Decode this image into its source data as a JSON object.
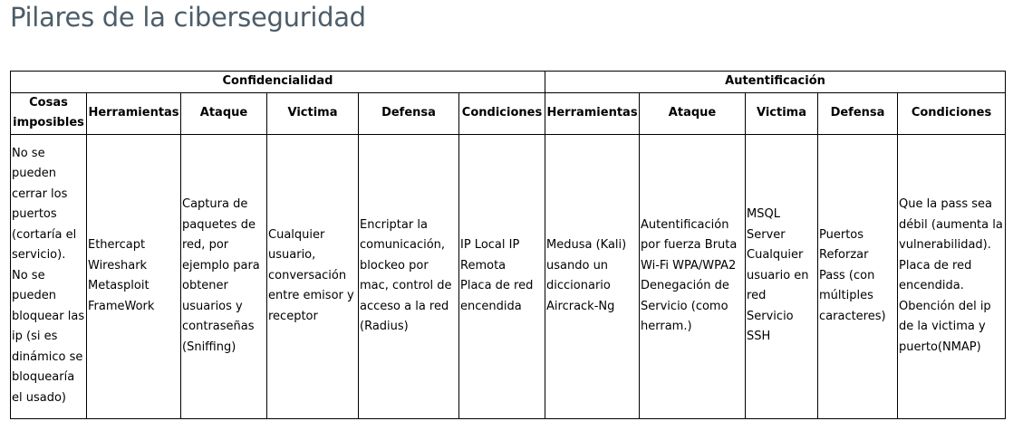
{
  "title": "Pilares de la ciberseguridad",
  "groups": [
    {
      "label": "Confidencialidad",
      "span": 6
    },
    {
      "label": "Autentificación",
      "span": 5
    }
  ],
  "columns": [
    "Cosas imposibles",
    "Herramientas",
    "Ataque",
    "Victima",
    "Defensa",
    "Condiciones",
    "Herramientas",
    "Ataque",
    "Victima",
    "Defensa",
    "Condiciones"
  ],
  "row": [
    "No se pueden cerrar los puertos (cortaría el servicio). No se pueden bloquear las ip (si es dinámico se bloquearía el usado)",
    "Ethercapt\nWireshark\nMetasploit\nFrameWork",
    "Captura de paquetes de red, por ejemplo para obtener usuarios y contraseñas (Sniffing)",
    "Cualquier usuario, conversación entre emisor y receptor",
    "Encriptar la comunicación, blockeo por mac, control de acceso a la red (Radius)",
    "IP Local IP Remota\nPlaca de red encendida",
    "Medusa (Kali) usando un diccionario\nAircrack-Ng",
    "Autentificación por fuerza Bruta Wi-Fi WPA/WPA2\nDenegación de Servicio (como herram.)",
    "MSQL Server\nCualquier usuario en red\nServicio SSH",
    "Puertos\nReforzar Pass (con múltiples caracteres)",
    "Que la pass sea débil (aumenta la vulnerabilidad).\nPlaca de red encendida.\nObención del ip de la victima y puerto(NMAP)"
  ]
}
